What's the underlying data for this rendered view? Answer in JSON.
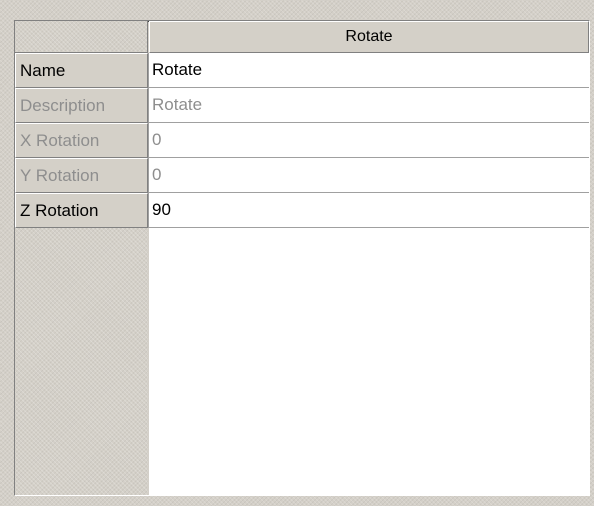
{
  "property_grid": {
    "column_header": "Rotate",
    "rows": [
      {
        "label": "Name",
        "value": "Rotate",
        "enabled": true
      },
      {
        "label": "Description",
        "value": "Rotate",
        "enabled": false
      },
      {
        "label": "X Rotation",
        "value": "0",
        "enabled": false
      },
      {
        "label": "Y Rotation",
        "value": "0",
        "enabled": false
      },
      {
        "label": "Z Rotation",
        "value": "90",
        "enabled": true
      }
    ]
  },
  "colors": {
    "panel": "#d4d0c8",
    "cell_background": "#ffffff",
    "disabled_text": "#8e8e8e",
    "enabled_text": "#000000"
  }
}
